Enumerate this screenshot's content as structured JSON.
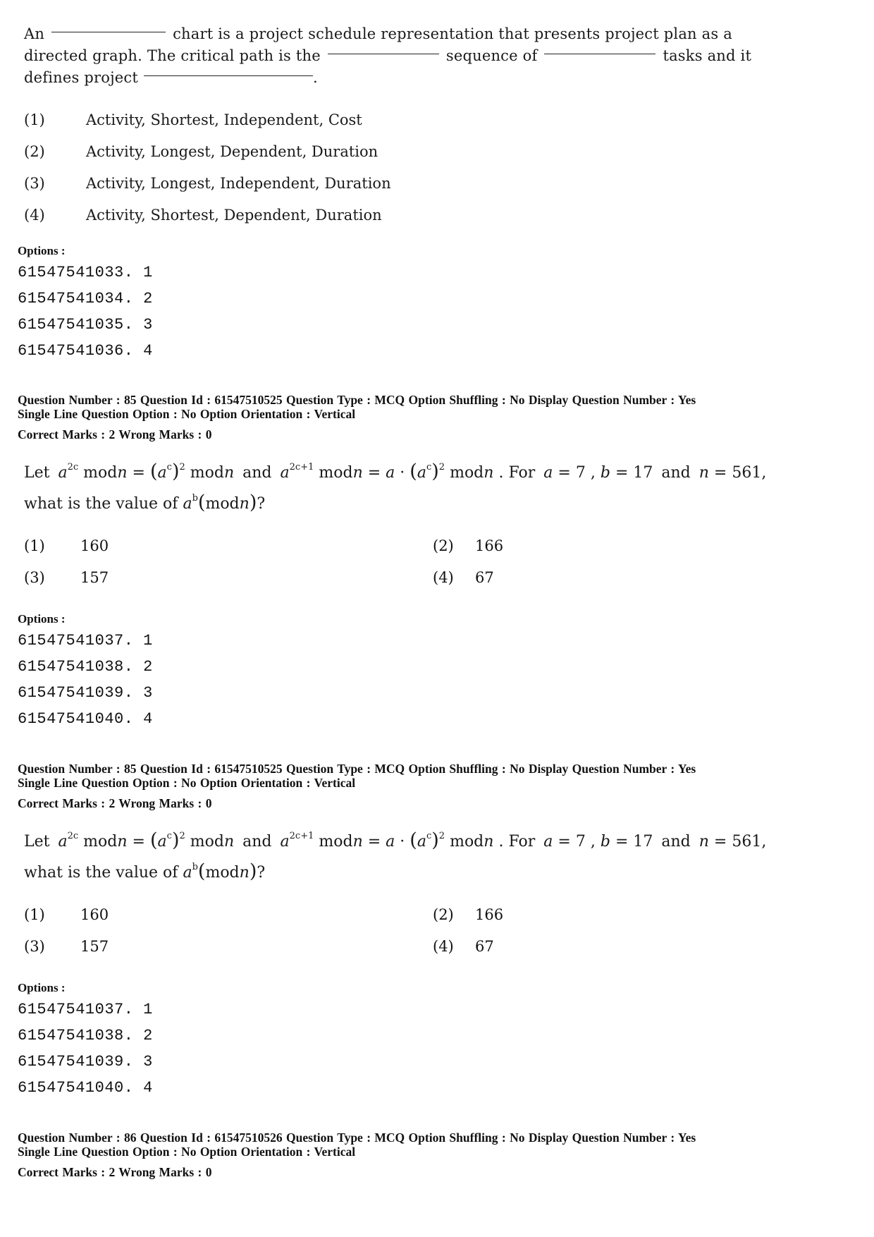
{
  "q84": {
    "stem": {
      "part1": "An",
      "part2": "chart is a project schedule representation  that presents project plan as a",
      "part3": "directed graph. The critical path is the",
      "part4": "sequence of",
      "part5": "tasks and it",
      "part6": "defines project",
      "part7": "."
    },
    "answers": [
      {
        "num": "(1)",
        "text": "Activity, Shortest, Independent, Cost"
      },
      {
        "num": "(2)",
        "text": "Activity, Longest, Dependent, Duration"
      },
      {
        "num": "(3)",
        "text": "Activity, Longest, Independent, Duration"
      },
      {
        "num": "(4)",
        "text": "Activity, Shortest, Dependent, Duration"
      }
    ],
    "options_label": "Options :",
    "option_ids": [
      "61547541033. 1",
      "61547541034. 2",
      "61547541035. 3",
      "61547541036. 4"
    ]
  },
  "q85a": {
    "meta_line1": "Question Number : 85  Question Id : 61547510525  Question Type : MCQ  Option Shuffling : No  Display Question Number : Yes",
    "meta_line2": "Single Line Question Option : No  Option Orientation : Vertical",
    "marks": "Correct Marks : 2  Wrong Marks : 0",
    "stem": {
      "let": "Let",
      "a": "a",
      "exp2c": "2c",
      "mod": "mod",
      "n": "n",
      "eq": "=",
      "c": "c",
      "sq": "2",
      "and": "and",
      "exp2c1": "2c+1",
      "dot": "·",
      "for": "For",
      "a_eq": "= 7",
      "b": "b",
      "b_eq": "= 17",
      "n_eq": "= 561",
      "comma": ",",
      "period": ".",
      "line2_prefix": "what is the value of",
      "b_exp": "b",
      "q": "?"
    },
    "answers": [
      {
        "num": "(1)",
        "text": "160"
      },
      {
        "num": "(2)",
        "text": "166"
      },
      {
        "num": "(3)",
        "text": "157"
      },
      {
        "num": "(4)",
        "text": "67"
      }
    ],
    "options_label": "Options :",
    "option_ids": [
      "61547541037. 1",
      "61547541038. 2",
      "61547541039. 3",
      "61547541040. 4"
    ]
  },
  "q85b": {
    "meta_line1": "Question Number : 85  Question Id : 61547510525  Question Type : MCQ  Option Shuffling : No  Display Question Number : Yes",
    "meta_line2": "Single Line Question Option : No  Option Orientation : Vertical",
    "marks": "Correct Marks : 2  Wrong Marks : 0",
    "answers": [
      {
        "num": "(1)",
        "text": "160"
      },
      {
        "num": "(2)",
        "text": "166"
      },
      {
        "num": "(3)",
        "text": "157"
      },
      {
        "num": "(4)",
        "text": "67"
      }
    ],
    "options_label": "Options :",
    "option_ids": [
      "61547541037. 1",
      "61547541038. 2",
      "61547541039. 3",
      "61547541040. 4"
    ]
  },
  "q86": {
    "meta_line1": "Question Number : 86  Question Id : 61547510526  Question Type : MCQ  Option Shuffling : No  Display Question Number : Yes",
    "meta_line2": "Single Line Question Option : No  Option Orientation : Vertical",
    "marks": "Correct Marks : 2  Wrong Marks : 0"
  }
}
